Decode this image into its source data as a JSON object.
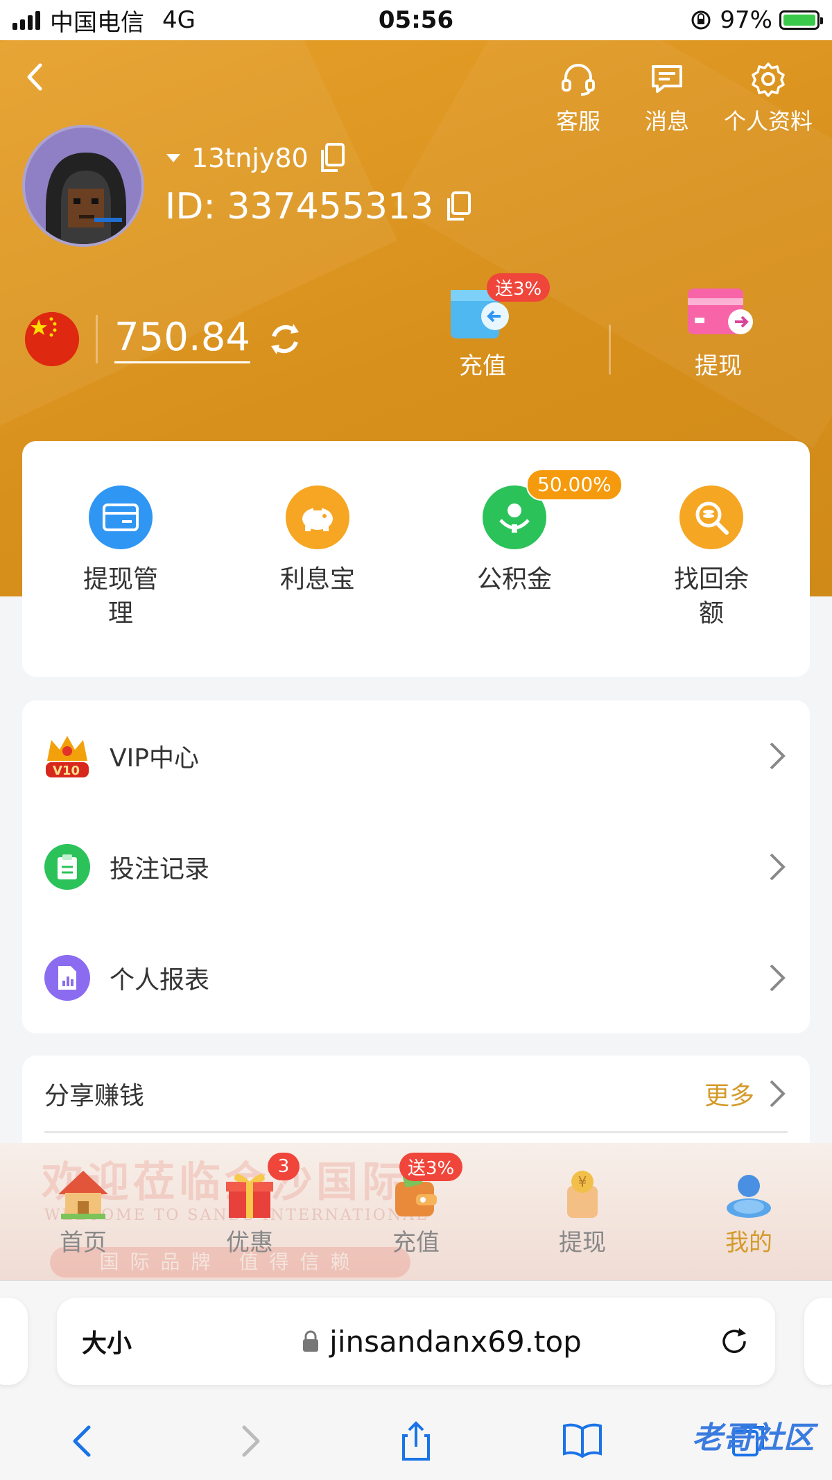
{
  "status": {
    "carrier": "中国电信",
    "network": "4G",
    "time": "05:56",
    "battery": "97%"
  },
  "header": {
    "icons": [
      {
        "label": "客服",
        "icon": "headset-icon"
      },
      {
        "label": "消息",
        "icon": "message-icon"
      },
      {
        "label": "个人资料",
        "icon": "gear-icon"
      }
    ],
    "username": "13tnjy80",
    "user_id": "ID: 337455313",
    "balance": "750.84",
    "recharge": {
      "label": "充值",
      "badge": "送3%"
    },
    "withdraw": {
      "label": "提现"
    }
  },
  "quick": [
    {
      "label": "提现管理",
      "icon": "card-icon",
      "color": "#2f96f3"
    },
    {
      "label": "利息宝",
      "icon": "piggy-bank-icon",
      "color": "#f6a623"
    },
    {
      "label": "公积金",
      "icon": "fund-icon",
      "color": "#2bc25a",
      "badge": "50.00%"
    },
    {
      "label": "找回余额",
      "icon": "search-coin-icon",
      "color": "#f5a623"
    }
  ],
  "menu": [
    {
      "label": "VIP中心",
      "icon": "crown-icon",
      "badge": "V10"
    },
    {
      "label": "投注记录",
      "icon": "clipboard-icon",
      "color": "#2bc25a"
    },
    {
      "label": "个人报表",
      "icon": "report-icon",
      "color": "#8b6cf0"
    }
  ],
  "share": {
    "title": "分享赚钱",
    "more": "更多"
  },
  "banner": {
    "line1": "欢迎莅临金沙国际",
    "line2": "WELCOME TO SANDS INTERNATIONAL",
    "line3": "国际品牌 值得信赖"
  },
  "tabs": [
    {
      "label": "首页",
      "icon": "home-icon"
    },
    {
      "label": "优惠",
      "icon": "gift-icon",
      "badge": "3"
    },
    {
      "label": "充值",
      "icon": "wallet-icon",
      "badge": "送3%"
    },
    {
      "label": "提现",
      "icon": "coin-jar-icon"
    },
    {
      "label": "我的",
      "icon": "profile-icon",
      "active": true
    }
  ],
  "browser": {
    "text_size": "大小",
    "url": "jinsandanx69.top"
  },
  "watermark": "老哥社区"
}
